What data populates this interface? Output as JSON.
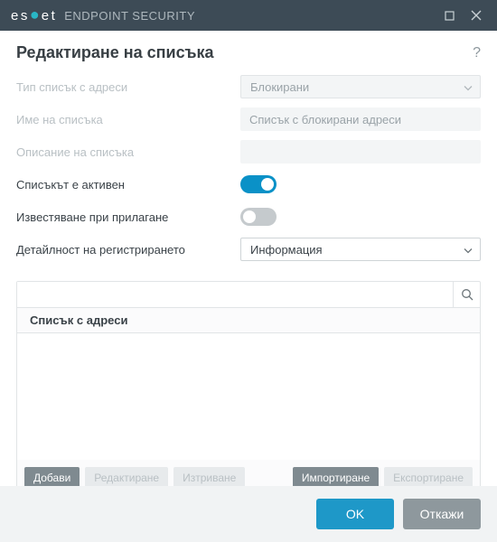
{
  "titlebar": {
    "brand_segments": [
      "e",
      "s",
      "e",
      "t"
    ],
    "product": "ENDPOINT SECURITY"
  },
  "heading": "Редактиране на списъка",
  "help_tooltip": "?",
  "form": {
    "address_list_type": {
      "label": "Тип списък с адреси",
      "value": "Блокирани"
    },
    "list_name": {
      "label": "Име на списъка",
      "value": "Списък с блокирани адреси"
    },
    "list_description": {
      "label": "Описание на списъка",
      "value": ""
    },
    "list_active": {
      "label": "Списъкът е активен",
      "on": true
    },
    "notify_on_apply": {
      "label": "Известяване при прилагане",
      "on": false
    },
    "log_detail": {
      "label": "Детайлност на регистрирането",
      "value": "Информация"
    }
  },
  "list": {
    "column_header": "Списък с адреси",
    "rows": [],
    "buttons": {
      "add": "Добави",
      "edit": "Редактиране",
      "delete": "Изтриване",
      "import": "Импортиране",
      "export": "Експортиране"
    }
  },
  "footer": {
    "ok": "OK",
    "cancel": "Откажи"
  }
}
